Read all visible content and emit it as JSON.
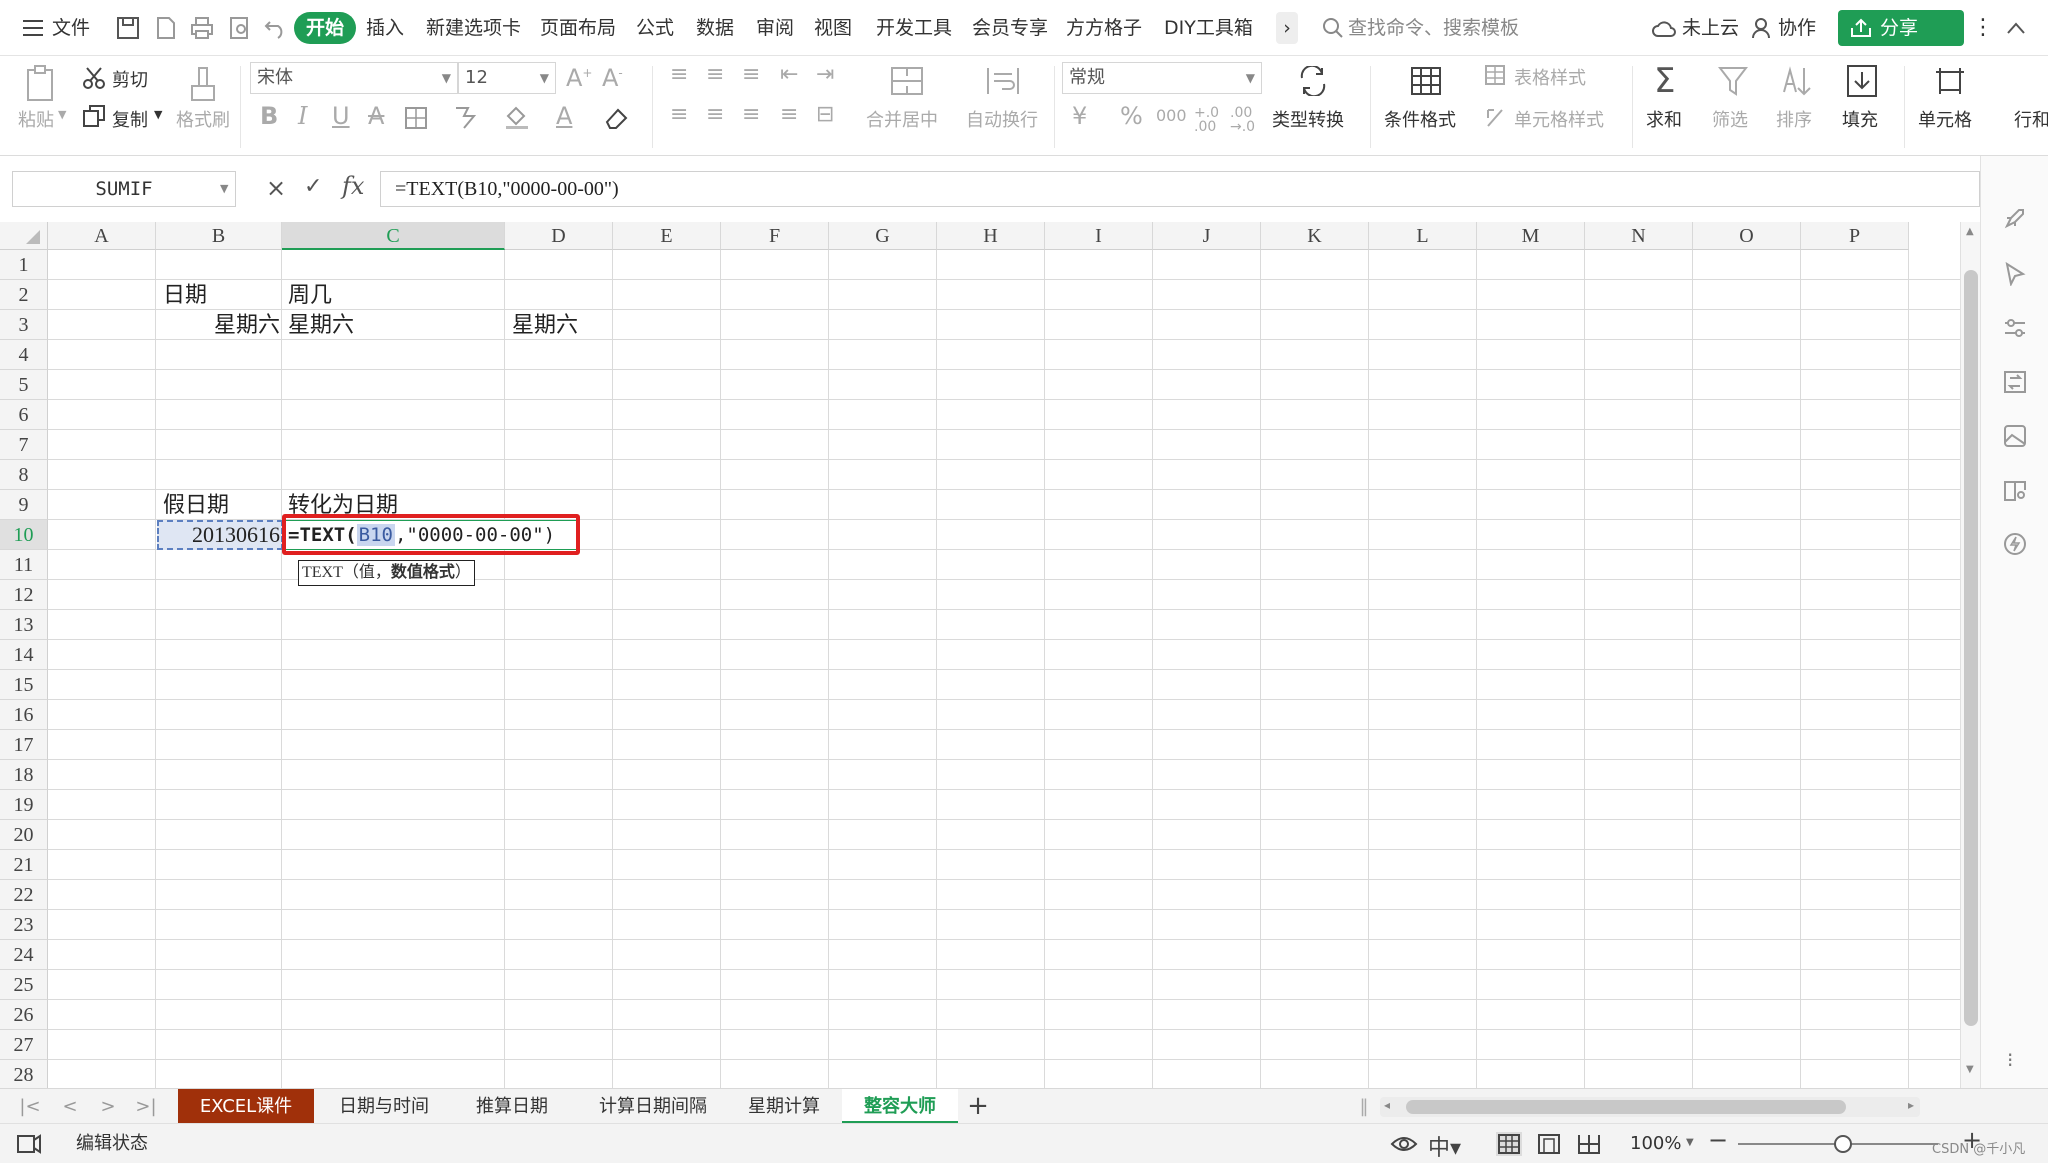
{
  "menubar": {
    "file_label": "文件",
    "tabs": [
      "开始",
      "插入",
      "新建选项卡",
      "页面布局",
      "公式",
      "数据",
      "审阅",
      "视图",
      "开发工具",
      "会员专享",
      "方方格子",
      "DIY工具箱"
    ],
    "more_label": "›",
    "search_placeholder": "查找命令、搜索模板",
    "cloud_label": "未上云",
    "collab_label": "协作",
    "share_label": "分享"
  },
  "ribbon": {
    "paste_label": "粘贴",
    "cut_label": "剪切",
    "copy_label": "复制",
    "format_painter_label": "格式刷",
    "font_name": "宋体",
    "font_size": "12",
    "merge_label": "合并居中",
    "wrap_label": "自动换行",
    "number_format": "常规",
    "type_convert_label": "类型转换",
    "cond_format_label": "条件格式",
    "table_style_label": "表格样式",
    "cell_style_label": "单元格样式",
    "sum_label": "求和",
    "filter_label": "筛选",
    "sort_label": "排序",
    "fill_label": "填充",
    "cell_label": "单元格",
    "rowcol_label": "行和"
  },
  "formula_bar": {
    "name_box": "SUMIF",
    "cancel_glyph": "×",
    "confirm_glyph": "✓",
    "fx_label": "fx",
    "formula": "=TEXT(B10,\"0000-00-00\")"
  },
  "grid": {
    "columns": [
      "A",
      "B",
      "C",
      "D",
      "E",
      "F",
      "G",
      "H",
      "I",
      "J",
      "K",
      "L",
      "M",
      "N",
      "O",
      "P"
    ],
    "selected_column": "C",
    "rows": [
      "1",
      "2",
      "3",
      "4",
      "5",
      "6",
      "7",
      "8",
      "9",
      "10",
      "11",
      "12",
      "13",
      "14",
      "15",
      "16",
      "17",
      "18",
      "19",
      "20",
      "21",
      "22",
      "23",
      "24",
      "25",
      "26",
      "27",
      "28"
    ],
    "selected_row": "10",
    "cells": {
      "B2": "日期",
      "C2": "周几",
      "B3": "星期六",
      "C3": "星期六",
      "D3": "星期六",
      "B9": "假日期",
      "C9": "转化为日期",
      "B10": "20130616"
    },
    "edit": {
      "fn": "=TEXT(",
      "ref": "B10",
      "rest": ",\"0000-00-00\")"
    },
    "tooltip": {
      "fn": "TEXT（值，",
      "arg": "数值格式",
      "close": "）"
    }
  },
  "sheet_tabs": [
    "EXCEL课件",
    "日期与时间",
    "推算日期",
    "计算日期间隔",
    "星期计算",
    "整容大师"
  ],
  "active_sheet": "整容大师",
  "add_sheet_label": "+",
  "status": {
    "mode": "编辑状态",
    "zoom": "100%",
    "watermark": "CSDN @千小凡"
  },
  "colors": {
    "accent": "#1f9d55",
    "active_tab_bg": "#a0300a",
    "highlight_box": "#e02020"
  }
}
